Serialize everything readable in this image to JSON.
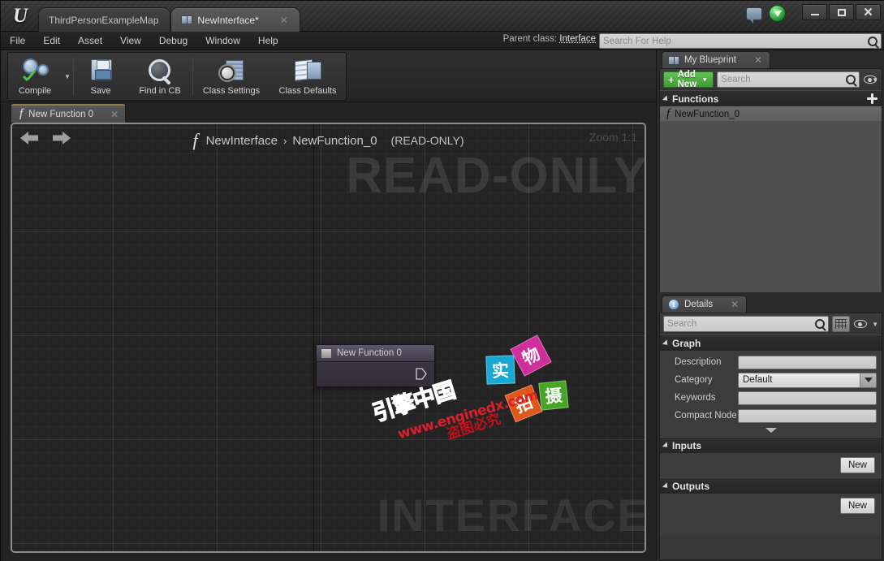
{
  "window": {
    "app_logo": "unreal-engine-logo",
    "tabs": [
      {
        "label": "ThirdPersonExampleMap",
        "icon": "",
        "active": false,
        "closable": false
      },
      {
        "label": "NewInterface*",
        "icon": "book-icon",
        "active": true,
        "closable": true
      }
    ],
    "tab_close_glyph": "✕",
    "controls": {
      "minimize": "–",
      "maximize": "□",
      "close": "✕"
    },
    "chat_icon": "chat-bubble-icon",
    "globe_icon": "green-globe-icon"
  },
  "menubar": {
    "items": [
      "File",
      "Edit",
      "Asset",
      "View",
      "Debug",
      "Window",
      "Help"
    ],
    "parent_class_label": "Parent class:",
    "parent_class_value": "Interface",
    "help_search_placeholder": "Search For Help",
    "help_search_value": ""
  },
  "toolbar": {
    "buttons": [
      {
        "label": "Compile",
        "icon": "compile-gears-check-icon",
        "has_dropdown": true
      },
      {
        "label": "Save",
        "icon": "floppy-disk-icon",
        "has_dropdown": false
      },
      {
        "label": "Find in CB",
        "icon": "magnifier-icon",
        "has_dropdown": false
      },
      {
        "label": "Class Settings",
        "icon": "class-settings-gear-icon",
        "has_dropdown": false
      },
      {
        "label": "Class Defaults",
        "icon": "class-defaults-icon",
        "has_dropdown": false
      }
    ]
  },
  "graph": {
    "function_tab": {
      "label": "New Function 0",
      "icon": "function-fx-icon",
      "close_glyph": "✕"
    },
    "breadcrumb": {
      "fx_icon": "function-fx-icon",
      "root": "NewInterface",
      "separator": "›",
      "current": "NewFunction_0",
      "state": "(READ-ONLY)"
    },
    "zoom_label": "Zoom 1:1",
    "watermark_readonly": "READ-ONLY",
    "watermark_interface": "INTERFACE",
    "nav_back_icon": "arrow-left-icon",
    "nav_forward_icon": "arrow-right-icon",
    "node": {
      "title": "New Function 0",
      "icon": "function-node-icon",
      "exec_pin": "exec-output-pin"
    },
    "overlay_watermark": {
      "boxes": [
        {
          "char": "实",
          "color": "#17a8d6"
        },
        {
          "char": "物",
          "color": "#cf2f9d"
        },
        {
          "char": "拍",
          "color": "#e0571c"
        },
        {
          "char": "摄",
          "color": "#46a526"
        }
      ],
      "brand": "引擎中国",
      "url": "www.enginedx.com",
      "warning": "盗图必究"
    }
  },
  "my_blueprint": {
    "tab_title": "My Blueprint",
    "tab_icon": "book-icon",
    "tab_close_glyph": "✕",
    "add_new_label": "Add New",
    "add_new_plus": "+",
    "add_new_caret": "▼",
    "search_placeholder": "Search",
    "search_value": "",
    "search_icon": "search-icon",
    "eye_icon": "eye-icon",
    "eye_caret": "▼",
    "sections": [
      {
        "title": "Functions",
        "add_icon": "plus-icon",
        "items": [
          {
            "label": "NewFunction_0",
            "icon": "function-fx-icon",
            "selected": true
          }
        ]
      }
    ]
  },
  "details": {
    "tab_title": "Details",
    "tab_icon": "info-icon",
    "tab_close_glyph": "✕",
    "search_placeholder": "Search",
    "search_value": "",
    "search_icon": "search-icon",
    "grid_icon": "grid-view-icon",
    "eye_icon": "eye-icon",
    "eye_caret": "▼",
    "groups": [
      {
        "title": "Graph",
        "rows": [
          {
            "label": "Description",
            "type": "text",
            "value": ""
          },
          {
            "label": "Category",
            "type": "combo",
            "value": "Default"
          },
          {
            "label": "Keywords",
            "type": "text",
            "value": ""
          },
          {
            "label": "Compact Node",
            "type": "text",
            "value": ""
          }
        ],
        "expander_icon": "expand-down-icon"
      },
      {
        "title": "Inputs",
        "new_button": "New"
      },
      {
        "title": "Outputs",
        "new_button": "New"
      }
    ]
  }
}
